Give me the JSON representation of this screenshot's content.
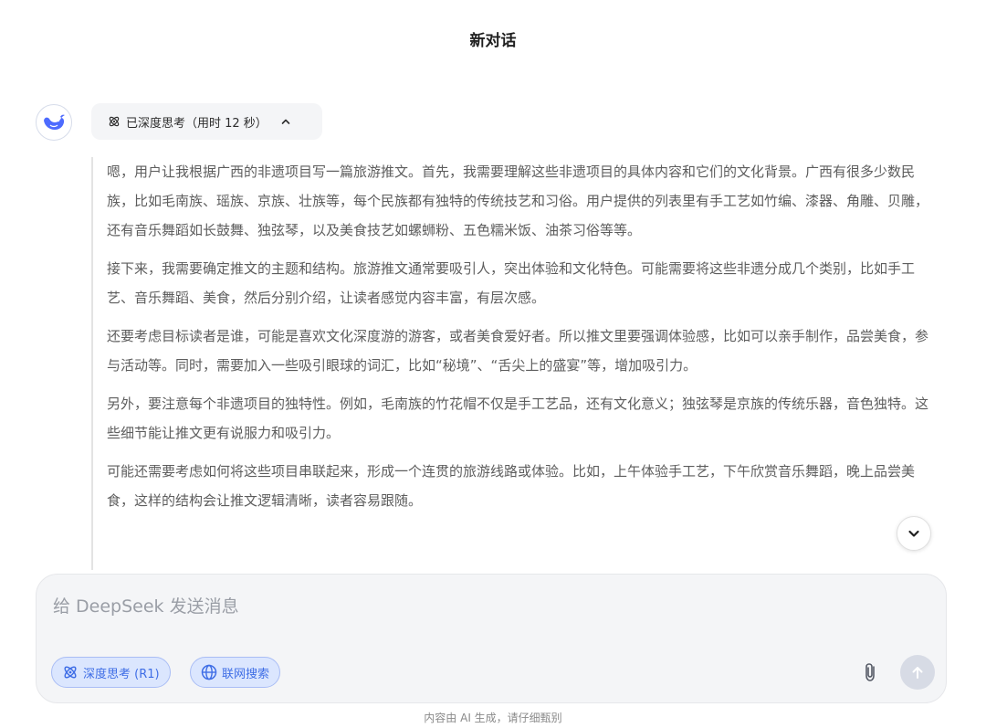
{
  "header": {
    "title": "新对话"
  },
  "assistant": {
    "think_status": "已深度思考（用时 12 秒）",
    "thought_paragraphs": [
      "嗯，用户让我根据广西的非遗项目写一篇旅游推文。首先，我需要理解这些非遗项目的具体内容和它们的文化背景。广西有很多少数民族，比如毛南族、瑶族、京族、壮族等，每个民族都有独特的传统技艺和习俗。用户提供的列表里有手工艺如竹编、漆器、角雕、贝雕，还有音乐舞蹈如长鼓舞、独弦琴，以及美食技艺如螺蛳粉、五色糯米饭、油茶习俗等等。",
      "接下来，我需要确定推文的主题和结构。旅游推文通常要吸引人，突出体验和文化特色。可能需要将这些非遗分成几个类别，比如手工艺、音乐舞蹈、美食，然后分别介绍，让读者感觉内容丰富，有层次感。",
      "还要考虑目标读者是谁，可能是喜欢文化深度游的游客，或者美食爱好者。所以推文里要强调体验感，比如可以亲手制作，品尝美食，参与活动等。同时，需要加入一些吸引眼球的词汇，比如“秘境”、“舌尖上的盛宴”等，增加吸引力。",
      "另外，要注意每个非遗项目的独特性。例如，毛南族的竹花帽不仅是手工艺品，还有文化意义；独弦琴是京族的传统乐器，音色独特。这些细节能让推文更有说服力和吸引力。",
      "可能还需要考虑如何将这些项目串联起来，形成一个连贯的旅游线路或体验。比如，上午体验手工艺，下午欣赏音乐舞蹈，晚上品尝美食，这样的结构会让推文逻辑清晰，读者容易跟随。"
    ]
  },
  "composer": {
    "placeholder": "给 DeepSeek 发送消息",
    "deep_think_label": "深度思考 (R1)",
    "web_search_label": "联网搜索"
  },
  "footer": {
    "disclaimer": "内容由 AI 生成，请仔细甄别"
  },
  "icons": {
    "logo": "deepseek-whale-icon",
    "think": "atom-icon",
    "collapse": "chevron-up-icon",
    "scroll": "chevron-down-icon",
    "globe": "globe-icon",
    "attach": "paperclip-icon",
    "send": "arrow-up-icon"
  },
  "colors": {
    "brand": "#4d6bfe",
    "chip_text": "#3f6ee6",
    "chip_bg": "#dbe6fe",
    "send_disabled": "#d7dbe5"
  }
}
